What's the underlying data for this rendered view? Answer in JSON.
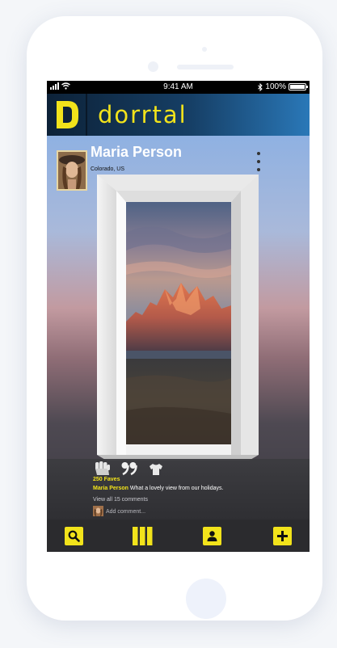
{
  "status_bar": {
    "time": "9:41 AM",
    "battery": "100%",
    "battery_level": 1.0
  },
  "app": {
    "name": "dorrtal"
  },
  "post": {
    "author": "Maria Person",
    "location": "Colorado, US",
    "faves": "250 Faves",
    "caption_author": "Maria Person",
    "caption_text": "What a lovely view from our holidays.",
    "view_comments": "View all 15 comments",
    "add_comment_placeholder": "Add comment..."
  },
  "icons": {
    "fave": "fist-icon",
    "comment": "quote-icon",
    "share": "shirt-icon",
    "tabs": [
      "search-icon",
      "doors-icon",
      "profile-icon",
      "add-icon"
    ]
  },
  "colors": {
    "accent": "#f2e31b",
    "appbar": "#163f66",
    "tabbar": "#2b2b2e"
  }
}
